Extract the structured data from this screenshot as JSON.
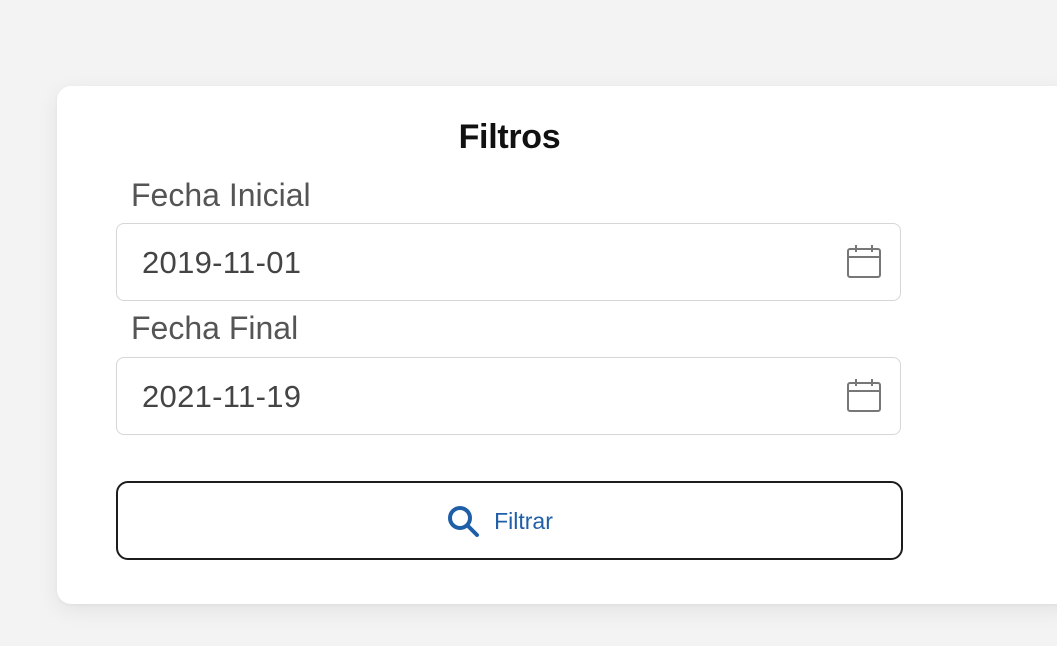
{
  "filters": {
    "title": "Filtros",
    "start_date": {
      "label": "Fecha Inicial",
      "value": "2019-11-01",
      "icon": "calendar-icon"
    },
    "end_date": {
      "label": "Fecha Final",
      "value": "2021-11-19",
      "icon": "calendar-icon"
    },
    "submit": {
      "label": "Filtrar",
      "icon": "search-icon",
      "label_color": "#1f5fa8"
    }
  },
  "colors": {
    "background": "#f3f3f3",
    "card": "#ffffff",
    "input_border": "#d6d6d6",
    "button_border": "#1c1c1c",
    "accent": "#1f5fa8"
  }
}
